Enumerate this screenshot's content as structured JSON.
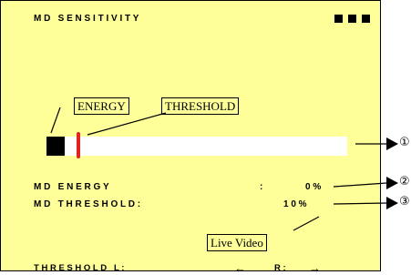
{
  "menu": {
    "title": "M D   S E N S I T I V I T Y",
    "energy_tag": "ENERGY",
    "threshold_tag": "THRESHOLD",
    "energy_row_label": "M D   E N E R G Y",
    "energy_row_sep": ":",
    "energy_value": "0 %",
    "threshold_row_label": "M D   T H R E S H O L D :",
    "threshold_value": "1 0 %",
    "live_video_button": "Live Video",
    "footer": "T H R E S H O L D   L :",
    "footer_left_arrow": "←",
    "footer_right_label": "R :",
    "footer_right_arrow": "→"
  },
  "sensitivity": {
    "energy_level": 0.0,
    "threshold_level": 0.1
  },
  "callouts": [
    "①",
    "②",
    "③"
  ],
  "colors": {
    "background": "#ffff99",
    "threshold_marker": "#e32222",
    "bar_track": "#ffffff"
  }
}
